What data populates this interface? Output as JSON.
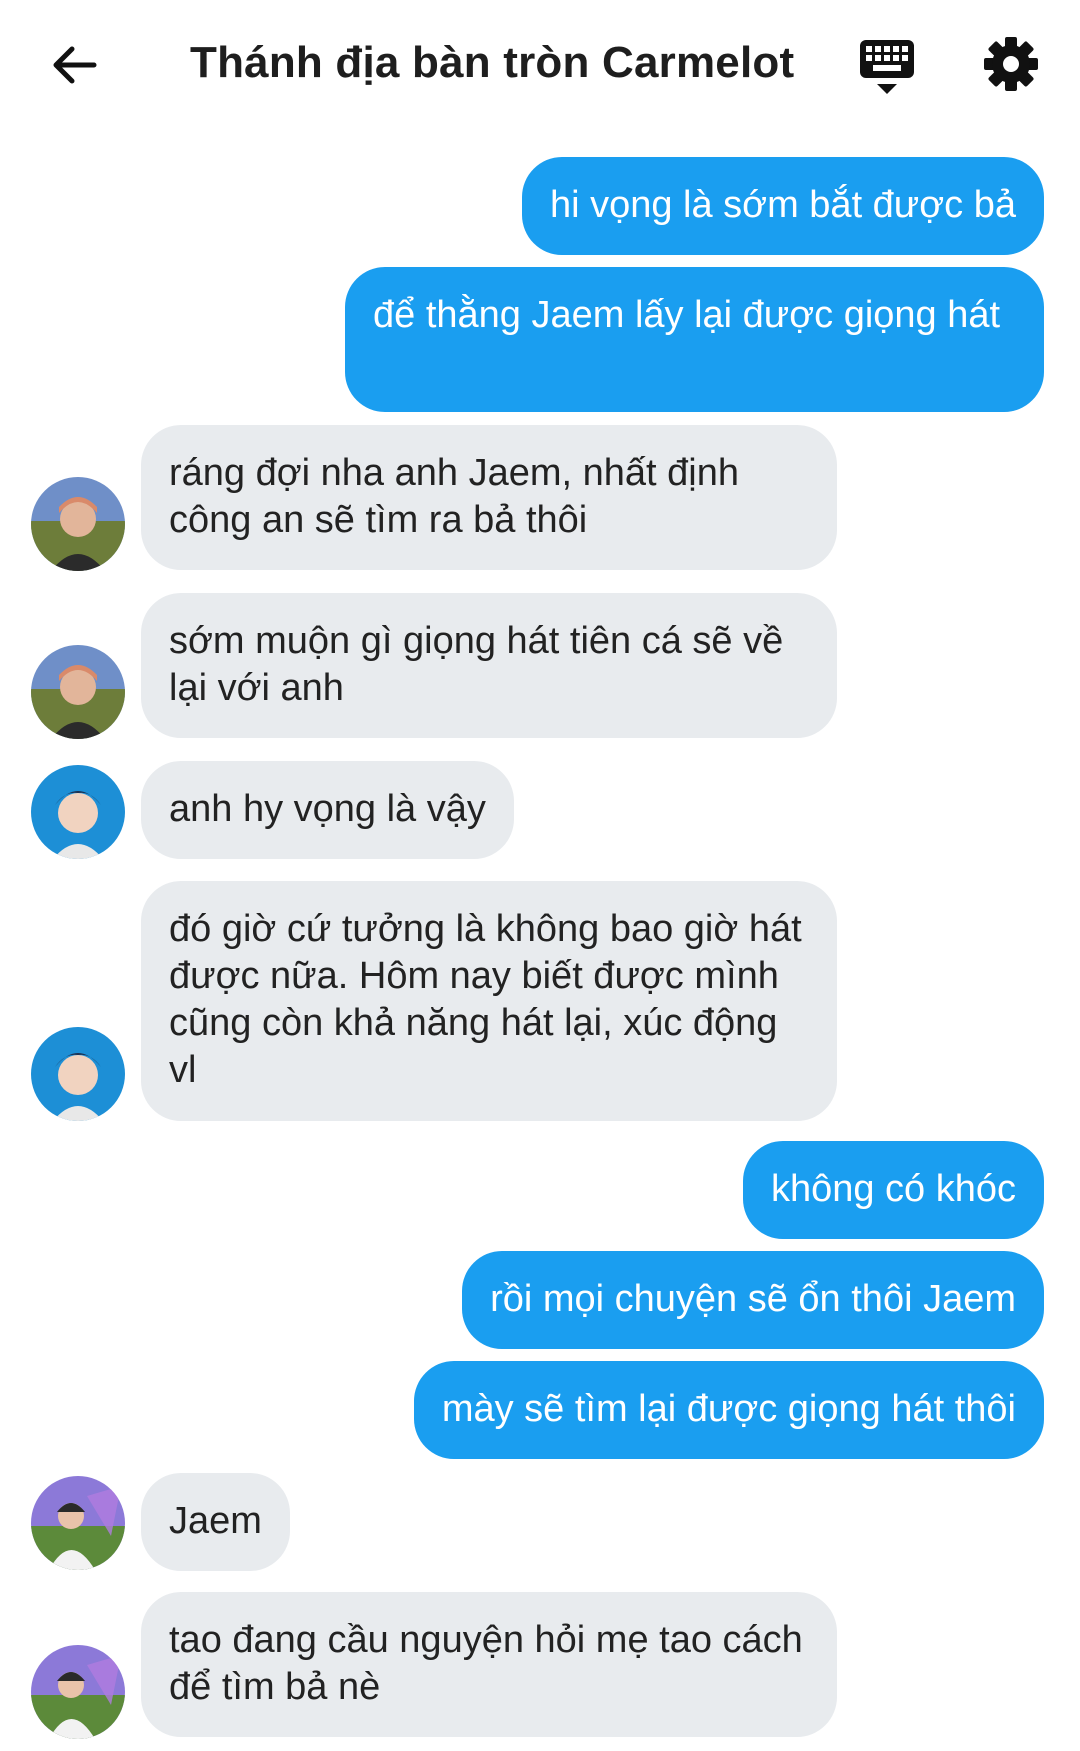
{
  "header": {
    "title": "Thánh địa bàn tròn Carmelot",
    "back_icon": "arrow-left-icon",
    "keyboard_icon": "keyboard-icon",
    "settings_icon": "gear-icon"
  },
  "colors": {
    "outgoing_bubble": "#1a9ef0",
    "incoming_bubble": "#e8ebee",
    "text_dark": "#222222"
  },
  "messages": [
    {
      "sender": "me",
      "text": "hi vọng là sớm bắt được bả"
    },
    {
      "sender": "me",
      "text": "để thằng Jaem lấy lại được giọng hát"
    },
    {
      "sender": "other",
      "avatar": "user-a",
      "text": "ráng đợi nha anh Jaem, nhất định công an sẽ tìm ra bả thôi"
    },
    {
      "sender": "other",
      "avatar": "user-a",
      "text": "sớm muộn gì giọng hát tiên cá sẽ về lại với anh"
    },
    {
      "sender": "other",
      "avatar": "user-b",
      "text": "anh hy vọng là vậy"
    },
    {
      "sender": "other",
      "avatar": "user-b",
      "text": "đó giờ cứ tưởng là không bao giờ hát được nữa. Hôm nay biết được mình cũng còn khả năng hát lại, xúc động vl"
    },
    {
      "sender": "me",
      "text": "không có khóc"
    },
    {
      "sender": "me",
      "text": "rồi mọi chuyện sẽ ổn thôi Jaem"
    },
    {
      "sender": "me",
      "text": "mày sẽ tìm lại được giọng hát thôi"
    },
    {
      "sender": "other",
      "avatar": "user-c",
      "text": "Jaem"
    },
    {
      "sender": "other",
      "avatar": "user-c",
      "text": "tao đang cầu nguyện hỏi mẹ tao cách để tìm bả nè"
    }
  ]
}
